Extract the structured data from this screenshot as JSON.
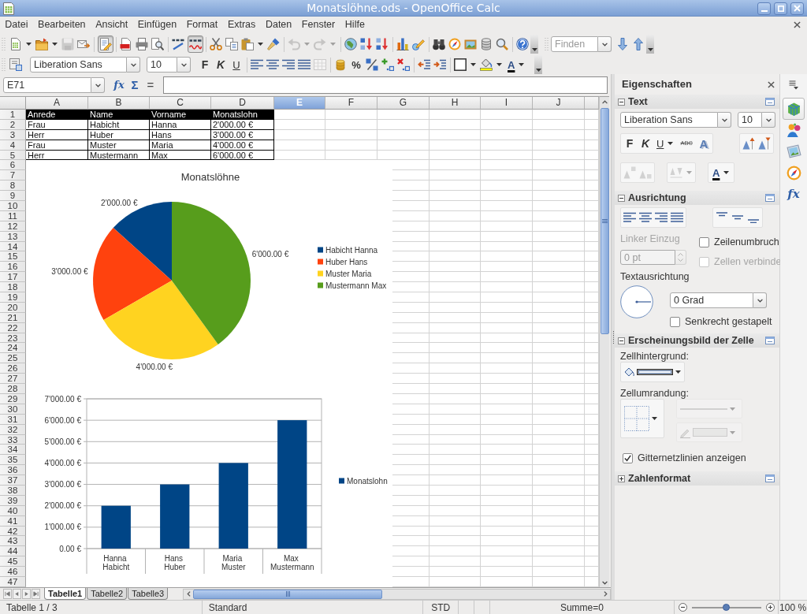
{
  "window": {
    "title": "Monatslöhne.ods - OpenOffice Calc"
  },
  "menu": [
    "Datei",
    "Bearbeiten",
    "Ansicht",
    "Einfügen",
    "Format",
    "Extras",
    "Daten",
    "Fenster",
    "Hilfe"
  ],
  "standard_toolbar": {
    "groups": [
      [
        {
          "kind": "new",
          "dropdown": true,
          "disabled": false,
          "pressed": false
        },
        {
          "kind": "open",
          "dropdown": true,
          "disabled": false,
          "pressed": false
        },
        {
          "kind": "save",
          "disabled": true,
          "pressed": false
        },
        {
          "kind": "email",
          "disabled": false,
          "pressed": false
        }
      ],
      [
        {
          "kind": "edit",
          "disabled": false,
          "pressed": true
        }
      ],
      [
        {
          "kind": "pdf",
          "disabled": false,
          "pressed": false
        },
        {
          "kind": "print",
          "disabled": false,
          "pressed": false
        },
        {
          "kind": "preview",
          "disabled": false,
          "pressed": false
        }
      ],
      [
        {
          "kind": "spellcheck",
          "disabled": false
        },
        {
          "kind": "autospell",
          "disabled": false,
          "pressed": true
        }
      ],
      [
        {
          "kind": "cut",
          "disabled": false,
          "pressed": false
        },
        {
          "kind": "copy",
          "disabled": false,
          "pressed": false
        },
        {
          "kind": "paste",
          "dropdown": true,
          "disabled": false,
          "pressed": false
        },
        {
          "kind": "clone",
          "disabled": false,
          "pressed": false
        }
      ],
      [
        {
          "kind": "undo",
          "dropdown": true,
          "disabled": true,
          "pressed": false
        },
        {
          "kind": "redo",
          "dropdown": true,
          "disabled": true,
          "pressed": false
        }
      ],
      [
        {
          "kind": "hyperlink",
          "disabled": false,
          "pressed": false
        },
        {
          "kind": "sort_ascending",
          "disabled": false,
          "pressed": false
        },
        {
          "kind": "sort_descending",
          "disabled": false,
          "pressed": false
        }
      ],
      [
        {
          "kind": "chart",
          "disabled": false,
          "pressed": false
        },
        {
          "kind": "draw",
          "disabled": false,
          "pressed": false
        }
      ],
      [
        {
          "kind": "find",
          "disabled": false,
          "pressed": false
        },
        {
          "kind": "navigator",
          "disabled": false,
          "pressed": false
        },
        {
          "kind": "gallery",
          "disabled": false,
          "pressed": false
        },
        {
          "kind": "data_sources",
          "disabled": false,
          "pressed": false
        },
        {
          "kind": "zoom",
          "disabled": false,
          "pressed": false
        }
      ],
      [
        {
          "kind": "help",
          "disabled": false,
          "pressed": false
        }
      ]
    ]
  },
  "find_toolbar": {
    "placeholder": "Finden"
  },
  "formatting_toolbar": {
    "font_name": "Liberation Sans",
    "font_size": "10",
    "groups": [
      [
        {
          "kind": "bold",
          "label": "F",
          "disabled": false,
          "pressed": false
        },
        {
          "kind": "italic",
          "label": "K",
          "disabled": false,
          "pressed": false
        },
        {
          "kind": "underline",
          "label": "U",
          "disabled": false,
          "pressed": false
        }
      ],
      [
        {
          "kind": "align_left",
          "disabled": false,
          "pressed": false
        },
        {
          "kind": "align_center",
          "disabled": false,
          "pressed": false
        },
        {
          "kind": "align_right",
          "disabled": false,
          "pressed": false
        },
        {
          "kind": "justify",
          "disabled": false,
          "pressed": false
        },
        {
          "kind": "merge",
          "disabled": true,
          "pressed": false
        }
      ],
      [
        {
          "kind": "currency",
          "disabled": false,
          "pressed": false
        },
        {
          "kind": "percent",
          "label": "%",
          "disabled": false,
          "pressed": false
        },
        {
          "kind": "number_standard",
          "disabled": false,
          "pressed": false
        },
        {
          "kind": "add_decimal",
          "disabled": false,
          "pressed": false
        },
        {
          "kind": "delete_decimal",
          "disabled": false,
          "pressed": false
        }
      ],
      [
        {
          "kind": "decrease_indent",
          "disabled": false,
          "pressed": false
        },
        {
          "kind": "increase_indent",
          "disabled": false,
          "pressed": false
        }
      ],
      [
        {
          "kind": "borders",
          "dropdown": true,
          "disabled": false,
          "pressed": false
        },
        {
          "kind": "background_color",
          "dropdown": true,
          "disabled": false,
          "pressed": false
        },
        {
          "kind": "font_color",
          "label": "A",
          "dropdown": true,
          "disabled": false,
          "pressed": false
        }
      ]
    ]
  },
  "formula_bar": {
    "cell_reference": "E71",
    "function_wizard_label": "fx",
    "sum_label": "Σ",
    "formula_label": "="
  },
  "sheet": {
    "columns": [
      {
        "label": "A",
        "selected": false
      },
      {
        "label": "B",
        "selected": false
      },
      {
        "label": "C",
        "selected": false
      },
      {
        "label": "D",
        "selected": false
      },
      {
        "label": "E",
        "selected": true
      },
      {
        "label": "F",
        "selected": false
      },
      {
        "label": "G",
        "selected": false
      },
      {
        "label": "H",
        "selected": false
      },
      {
        "label": "I",
        "selected": false
      },
      {
        "label": "J",
        "selected": false
      }
    ],
    "row_headers": [
      "1",
      "2",
      "3",
      "4",
      "5",
      "6",
      "7",
      "8",
      "9",
      "10",
      "11",
      "12",
      "13",
      "14",
      "15",
      "16",
      "17",
      "18",
      "19",
      "20",
      "21",
      "22",
      "23",
      "24",
      "25",
      "26",
      "27",
      "28",
      "29",
      "30",
      "31",
      "32",
      "33",
      "34",
      "35",
      "36",
      "37",
      "38",
      "39",
      "40",
      "41",
      "42",
      "43",
      "44",
      "45",
      "46",
      "47"
    ],
    "rows": [
      {
        "kind": "header",
        "cells": [
          "Anrede",
          "Name",
          "Vorname",
          "Monatslohn"
        ]
      },
      {
        "kind": "data",
        "cells": [
          "Frau",
          "Habicht",
          "Hanna",
          "2'000.00 €"
        ]
      },
      {
        "kind": "data",
        "cells": [
          "Herr",
          "Huber",
          "Hans",
          "3'000.00 €"
        ]
      },
      {
        "kind": "data",
        "cells": [
          "Frau",
          "Muster",
          "Maria",
          "4'000.00 €"
        ]
      },
      {
        "kind": "data",
        "cells": [
          "Herr",
          "Mustermann",
          "Max",
          "6'000.00 €"
        ]
      }
    ],
    "charts": [
      {
        "chart_data": {
          "type": "pie",
          "title": "Monatslöhne",
          "categories": [
            "Habicht Hanna",
            "Huber Hans",
            "Muster Maria",
            "Mustermann Max"
          ],
          "values": [
            2000,
            3000,
            4000,
            6000
          ],
          "colors": [
            "#004586",
            "#ff420e",
            "#ffd320",
            "#579d1c"
          ],
          "value_labels": [
            "2'000.00 €",
            "3'000.00 €",
            "4'000.00 €",
            "6'000.00 €"
          ],
          "legend": "right"
        }
      },
      {
        "chart_data": {
          "type": "bar",
          "categories": [
            "Hanna Habicht",
            "Hans Huber",
            "Maria Muster",
            "Max Mustermann"
          ],
          "series": [
            {
              "name": "Monatslohn",
              "color": "#004586",
              "values": [
                2000,
                3000,
                4000,
                6000
              ]
            }
          ],
          "ylim": [
            0,
            7000
          ],
          "yticks": [
            {
              "value": 0,
              "label": "0.00 €"
            },
            {
              "value": 1000,
              "label": "1'000.00 €"
            },
            {
              "value": 2000,
              "label": "2'000.00 €"
            },
            {
              "value": 3000,
              "label": "3'000.00 €"
            },
            {
              "value": 4000,
              "label": "4'000.00 €"
            },
            {
              "value": 5000,
              "label": "5'000.00 €"
            },
            {
              "value": 6000,
              "label": "6'000.00 €"
            },
            {
              "value": 7000,
              "label": "7'000.00 €"
            }
          ],
          "grid": true,
          "legend": "right"
        }
      }
    ]
  },
  "sheet_tabs": [
    {
      "label": "Tabelle1",
      "selected": true
    },
    {
      "label": "Tabelle2",
      "selected": false
    },
    {
      "label": "Tabelle3",
      "selected": false
    }
  ],
  "sidebar": {
    "title": "Eigenschaften",
    "tabs": [
      {
        "kind": "properties",
        "selected": true
      },
      {
        "kind": "styles",
        "selected": false
      },
      {
        "kind": "gallery",
        "selected": false
      },
      {
        "kind": "navigator",
        "selected": false
      },
      {
        "kind": "functions",
        "label": "fx",
        "selected": false
      }
    ],
    "sections": [
      {
        "kind": "text",
        "title": "Text",
        "expanded": true,
        "font_name": "Liberation Sans",
        "font_size": "10",
        "button_rows": [
          [
            [
              {
                "kind": "bold",
                "label": "F",
                "disabled": false,
                "pressed": false
              },
              {
                "kind": "italic",
                "label": "K",
                "disabled": false,
                "pressed": false
              },
              {
                "kind": "underline",
                "label": "U",
                "dropdown": true,
                "disabled": false,
                "pressed": false
              },
              {
                "kind": "strikethrough",
                "label": "ABC",
                "disabled": false,
                "pressed": false
              },
              {
                "kind": "shadow",
                "label": "A",
                "disabled": false,
                "pressed": false
              }
            ],
            [
              {
                "kind": "grow",
                "disabled": false,
                "pressed": false
              },
              {
                "kind": "shrink",
                "disabled": false,
                "pressed": false
              }
            ]
          ],
          [
            [
              {
                "kind": "superscript",
                "disabled": true,
                "pressed": false
              },
              {
                "kind": "subscript",
                "disabled": true,
                "pressed": false
              }
            ],
            [
              {
                "kind": "spacing",
                "dropdown": true,
                "disabled": true,
                "pressed": false
              }
            ],
            [
              {
                "kind": "font_color",
                "label": "A",
                "dropdown": true,
                "disabled": false,
                "pressed": false
              }
            ]
          ]
        ]
      },
      {
        "kind": "alignment",
        "title": "Ausrichtung",
        "expanded": true,
        "button_rows": [
          [
            [
              {
                "kind": "align_left",
                "disabled": false,
                "pressed": false
              },
              {
                "kind": "align_center",
                "disabled": false,
                "pressed": false
              },
              {
                "kind": "align_right",
                "disabled": false,
                "pressed": false
              },
              {
                "kind": "justify",
                "disabled": false,
                "pressed": false
              }
            ],
            [
              {
                "kind": "valign_top",
                "disabled": false,
                "pressed": false
              },
              {
                "kind": "valign_middle",
                "disabled": false,
                "pressed": false
              },
              {
                "kind": "valign_bottom",
                "disabled": false,
                "pressed": false
              }
            ]
          ]
        ],
        "indent": {
          "label": "Linker Einzug",
          "value": "0 pt",
          "disabled": true
        },
        "options": [
          {
            "label": "Zeilenumbruch",
            "checked": false,
            "disabled": false
          },
          {
            "label": "Zellen verbinde",
            "checked": false,
            "disabled": true
          }
        ],
        "orientation_label": "Textausrichtung",
        "angle": "0 Grad",
        "stacked": {
          "label": "Senkrecht gestapelt",
          "checked": false,
          "disabled": false
        }
      },
      {
        "kind": "cell_appearance",
        "title": "Erscheinungsbild der Zelle",
        "expanded": true,
        "background_label": "Zellhintergrund:",
        "border_label": "Zellumrandung:",
        "line_style": {
          "disabled": true
        },
        "line_color": {
          "disabled": true
        },
        "gridlines": {
          "label": "Gitternetzlinien anzeigen",
          "checked": true,
          "disabled": false
        }
      },
      {
        "kind": "number_format",
        "title": "Zahlenformat",
        "expanded": false
      }
    ]
  },
  "status_bar": {
    "sheet": "Tabelle 1 / 3",
    "page_style": "Standard",
    "mode": "STD",
    "sum": "Summe=0",
    "zoom": "100 %",
    "zoom_slider": {
      "level": 0.5
    }
  }
}
